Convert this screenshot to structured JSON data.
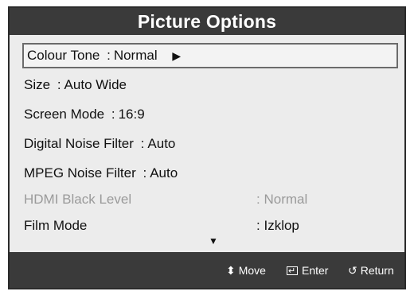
{
  "title": "Picture Options",
  "items": [
    {
      "label": "Colour Tone",
      "sep": ":",
      "value": "Normal",
      "has_arrow": true,
      "selected": true,
      "disabled": false
    },
    {
      "label": "Size",
      "sep": ":",
      "value": "Auto Wide",
      "has_arrow": false,
      "selected": false,
      "disabled": false
    },
    {
      "label": "Screen Mode",
      "sep": ":",
      "value": "16:9",
      "has_arrow": false,
      "selected": false,
      "disabled": false
    },
    {
      "label": "Digital Noise Filter",
      "sep": ":",
      "value": "Auto",
      "has_arrow": false,
      "selected": false,
      "disabled": false
    },
    {
      "label": "MPEG Noise Filter",
      "sep": ":",
      "value": "Auto",
      "has_arrow": false,
      "selected": false,
      "disabled": false
    },
    {
      "label": "HDMI Black Level",
      "sep": ":",
      "value": "Normal",
      "has_arrow": false,
      "selected": false,
      "disabled": true
    },
    {
      "label": "Film Mode",
      "sep": ":",
      "value": "Izklop",
      "has_arrow": false,
      "selected": false,
      "disabled": false
    }
  ],
  "more_indicator": "▼",
  "footer": {
    "move_label": "Move",
    "enter_label": "Enter",
    "return_label": "Return",
    "move_icon": "updown-arrows-icon",
    "enter_icon": "enter-icon",
    "return_icon": "return-icon"
  },
  "colors": {
    "bar_bg": "#3a3a3a",
    "panel_bg": "#ececec",
    "disabled_text": "#9a9a9a"
  }
}
